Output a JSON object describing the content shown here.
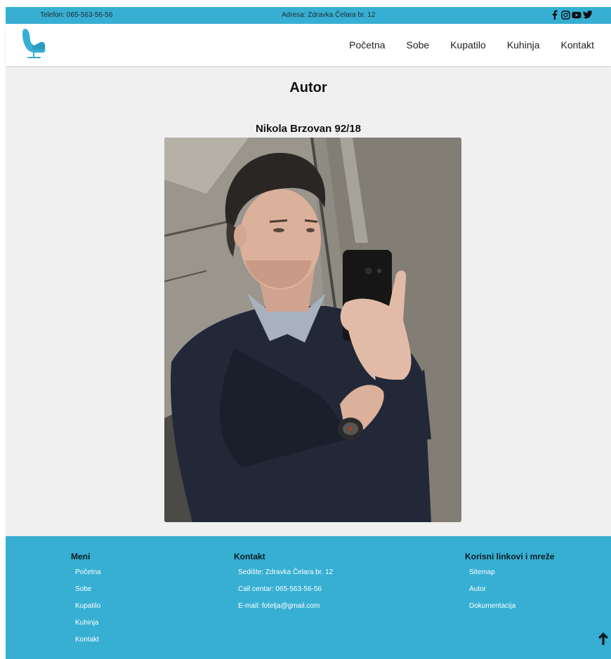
{
  "topbar": {
    "phone": "Telefon: 065-563-56-56",
    "address": "Adresa: Zdravka Čelara br. 12",
    "social_icons": [
      "facebook-icon",
      "instagram-icon",
      "youtube-icon",
      "twitter-icon"
    ]
  },
  "nav": {
    "logo_icon": "armchair-icon",
    "items": [
      "Početna",
      "Sobe",
      "Kupatilo",
      "Kuhinja",
      "Kontakt"
    ]
  },
  "main": {
    "title": "Autor",
    "author_name": "Nikola Brzovan 92/18"
  },
  "footer": {
    "meni": {
      "title": "Meni",
      "items": [
        "Početna",
        "Sobe",
        "Kupatilo",
        "Kuhinja",
        "Kontakt"
      ]
    },
    "kontakt": {
      "title": "Kontakt",
      "items": [
        "Sedište: Zdravka Čelara br. 12",
        "Call centar: 065-563-56-56",
        "E-mail: fotelja@gmail.com"
      ]
    },
    "links": {
      "title": "Korisni linkovi i mreže",
      "items": [
        "Sitemap",
        "Autor",
        "Dokumentacija"
      ]
    },
    "scroll_top_icon": "arrow-up-icon"
  },
  "colors": {
    "accent": "#37afd3",
    "background": "#f0f0f0",
    "navbar": "#ffffff"
  }
}
